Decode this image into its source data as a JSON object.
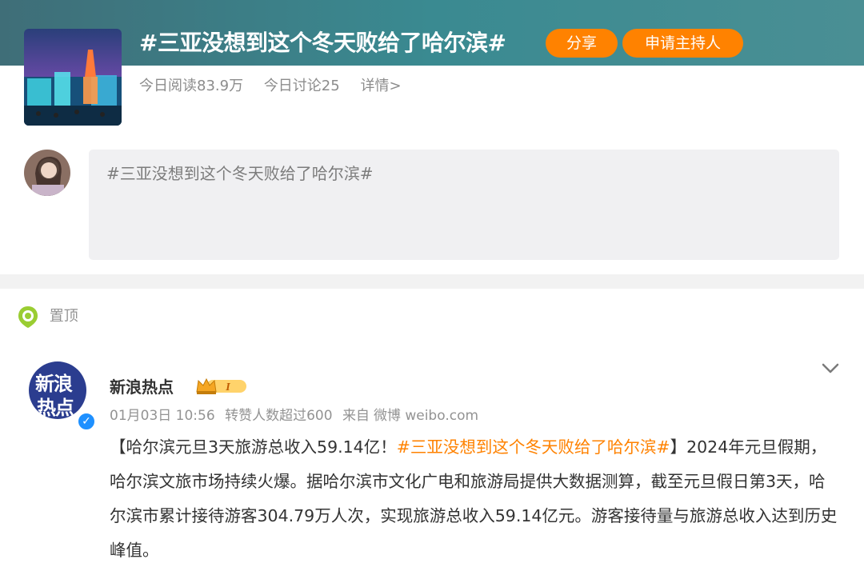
{
  "topic": {
    "title": "#三亚没想到这个冬天败给了哈尔滨#",
    "share_label": "分享",
    "host_label": "申请主持人",
    "reads": "今日阅读83.9万",
    "discussions": "今日讨论25",
    "details_link": "详情>"
  },
  "composer": {
    "placeholder_text": "#三亚没想到这个冬天败给了哈尔滨#"
  },
  "pinned": {
    "label": "置顶"
  },
  "post": {
    "avatar_text_line1": "新浪",
    "avatar_text_line2": "热点",
    "verified_mark": "✓",
    "author": "新浪热点",
    "badge_level": "I",
    "date": "01月03日 10:56",
    "reposts_info": "转赞人数超过600",
    "source_prefix": "来自",
    "source": "微博 weibo.com",
    "text_lead": "【哈尔滨元旦3天旅游总收入59.14亿！",
    "text_tag": "#三亚没想到这个冬天败给了哈尔滨#",
    "text_body": "】2024年元旦假期，哈尔滨文旅市场持续火爆。据哈尔滨市文化广电和旅游局提供大数据测算，截至元旦假日第3天，哈尔滨市累计接待游客304.79万人次，实现旅游总收入59.14亿元。游客接待量与旅游总收入达到历史峰值。"
  },
  "colors": {
    "accent_orange": "#ff8200",
    "banner_teal": "#3a8a91",
    "verify_blue": "#1e90ff",
    "pin_green": "#9acd32"
  },
  "icons": [
    "pin-icon",
    "chevron-down-icon",
    "verified-icon",
    "crown-badge-icon"
  ]
}
